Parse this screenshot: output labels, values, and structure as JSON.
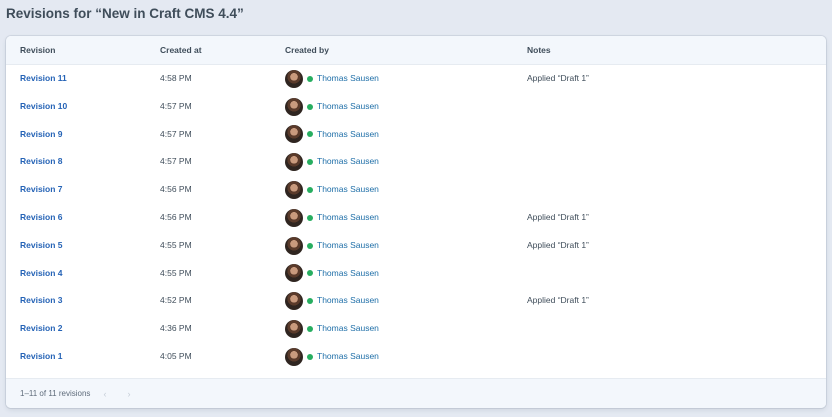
{
  "page": {
    "title": "Revisions for “New in Craft CMS 4.4”"
  },
  "table": {
    "headers": {
      "revision": "Revision",
      "created_at": "Created at",
      "created_by": "Created by",
      "notes": "Notes"
    },
    "rows": [
      {
        "revision": "Revision 11",
        "created_at": "4:58 PM",
        "created_by": "Thomas Sausen",
        "notes": "Applied “Draft 1”"
      },
      {
        "revision": "Revision 10",
        "created_at": "4:57 PM",
        "created_by": "Thomas Sausen",
        "notes": ""
      },
      {
        "revision": "Revision 9",
        "created_at": "4:57 PM",
        "created_by": "Thomas Sausen",
        "notes": ""
      },
      {
        "revision": "Revision 8",
        "created_at": "4:57 PM",
        "created_by": "Thomas Sausen",
        "notes": ""
      },
      {
        "revision": "Revision 7",
        "created_at": "4:56 PM",
        "created_by": "Thomas Sausen",
        "notes": ""
      },
      {
        "revision": "Revision 6",
        "created_at": "4:56 PM",
        "created_by": "Thomas Sausen",
        "notes": "Applied “Draft 1”"
      },
      {
        "revision": "Revision 5",
        "created_at": "4:55 PM",
        "created_by": "Thomas Sausen",
        "notes": "Applied “Draft 1”"
      },
      {
        "revision": "Revision 4",
        "created_at": "4:55 PM",
        "created_by": "Thomas Sausen",
        "notes": ""
      },
      {
        "revision": "Revision 3",
        "created_at": "4:52 PM",
        "created_by": "Thomas Sausen",
        "notes": "Applied “Draft 1”"
      },
      {
        "revision": "Revision 2",
        "created_at": "4:36 PM",
        "created_by": "Thomas Sausen",
        "notes": ""
      },
      {
        "revision": "Revision 1",
        "created_at": "4:05 PM",
        "created_by": "Thomas Sausen",
        "notes": ""
      }
    ]
  },
  "footer": {
    "pagination_text": "1–11 of 11 revisions",
    "prev_icon": "‹",
    "next_icon": "›"
  },
  "icons": {
    "avatar": "user-avatar",
    "status": "status-dot-icon",
    "prev": "chevron-left-icon",
    "next": "chevron-right-icon"
  },
  "colors": {
    "link": "#2563b6",
    "status_active": "#27ae60",
    "background": "#e4e9f2"
  }
}
